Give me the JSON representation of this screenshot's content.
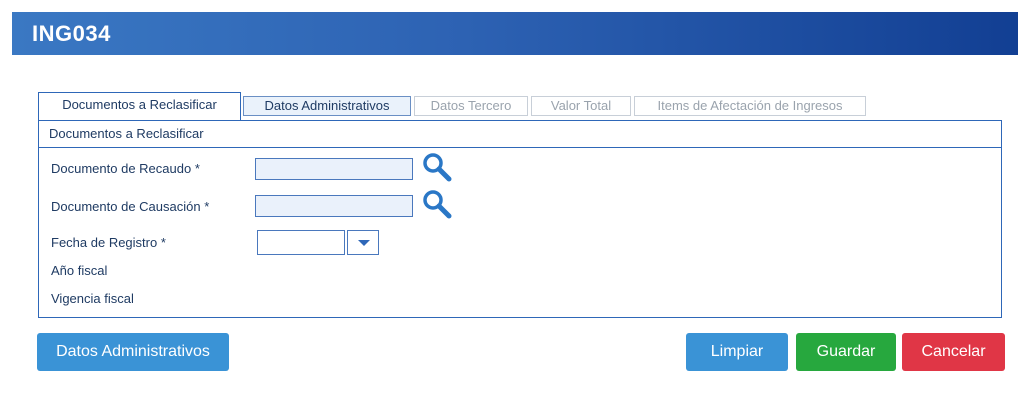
{
  "app": {
    "title": "ING034"
  },
  "tabs": [
    {
      "label": "Documentos a Reclasificar",
      "state": "active"
    },
    {
      "label": "Datos Administrativos",
      "state": "normal"
    },
    {
      "label": "Datos Tercero",
      "state": "disabled"
    },
    {
      "label": "Valor Total",
      "state": "disabled"
    },
    {
      "label": "Items de Afectación de Ingresos",
      "state": "disabled"
    }
  ],
  "panel": {
    "header": "Documentos a Reclasificar",
    "fields": {
      "documento_recaudo": {
        "label": "Documento de Recaudo *",
        "value": ""
      },
      "documento_causacion": {
        "label": "Documento de Causación *",
        "value": ""
      },
      "fecha_registro": {
        "label": "Fecha de Registro *",
        "value": ""
      },
      "anio_fiscal": {
        "label": "Año fiscal"
      },
      "vigencia_fiscal": {
        "label": "Vigencia fiscal"
      }
    }
  },
  "buttons": {
    "datos_administrativos": "Datos Administrativos",
    "limpiar": "Limpiar",
    "guardar": "Guardar",
    "cancelar": "Cancelar"
  },
  "icons": {
    "search": "search-icon",
    "dropdown": "chevron-down-icon"
  },
  "colors": {
    "title_gradient_start": "#3a78c3",
    "title_gradient_end": "#123f93",
    "accent_blue": "#3a93d6",
    "save_green": "#27a83e",
    "cancel_red": "#e03646"
  }
}
